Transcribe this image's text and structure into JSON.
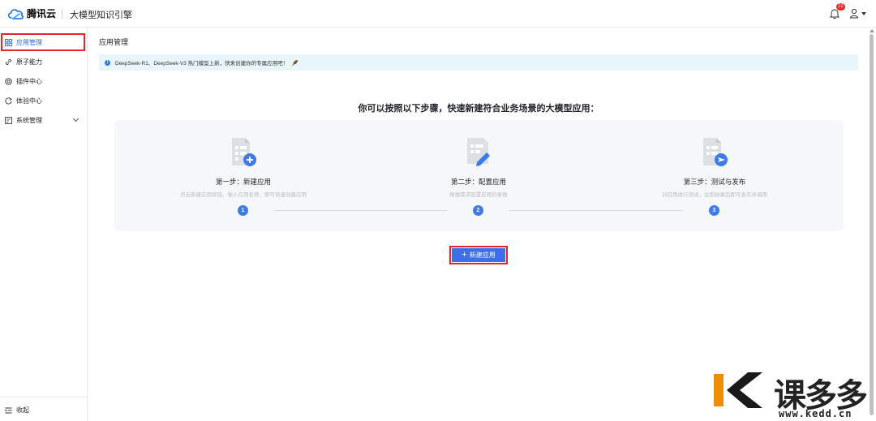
{
  "header": {
    "brand": "腾讯云",
    "product": "大模型知识引擎",
    "notification_count": "22",
    "icons": {
      "logo": "tencent-cloud-logo",
      "bell": "bell-icon",
      "user": "user-icon"
    }
  },
  "sidebar": {
    "items": [
      {
        "label": "应用管理",
        "icon": "app-grid-icon",
        "active": true
      },
      {
        "label": "原子能力",
        "icon": "link-icon"
      },
      {
        "label": "插件中心",
        "icon": "plugin-icon"
      },
      {
        "label": "体验中心",
        "icon": "experience-icon"
      },
      {
        "label": "系统管理",
        "icon": "system-icon",
        "expandable": true
      }
    ],
    "collapse_label": "收起"
  },
  "main": {
    "page_title": "应用管理",
    "notice": "DeepSeek-R1、DeepSeek-V3 热门模型上新，快来创建你的专属应用吧！",
    "headline": "你可以按照以下步骤，快速新建符合业务场景的大模型应用：",
    "steps": [
      {
        "number": "1",
        "title": "第一步：新建应用",
        "desc": "点击新建应用按钮，输入应用名称，即可快速创建应用",
        "icon": "doc-add-icon"
      },
      {
        "number": "2",
        "title": "第二步：配置应用",
        "desc": "根据需求配置应用的参数",
        "icon": "doc-edit-icon"
      },
      {
        "number": "3",
        "title": "第三步：测试与发布",
        "desc": "对应用进行测试，达到效果后即可发布并调用",
        "icon": "doc-send-icon"
      }
    ],
    "create_button": "新建应用"
  },
  "watermark": {
    "brand": "课多多",
    "url": "www.kedd.cn"
  },
  "colors": {
    "accent": "#3d6fe8",
    "active_text": "#266fe8",
    "highlight_border": "#e3262b",
    "notice_bg": "#e8f6fb",
    "card_bg": "#f5f7fa",
    "watermark_orange": "#f08c00"
  }
}
